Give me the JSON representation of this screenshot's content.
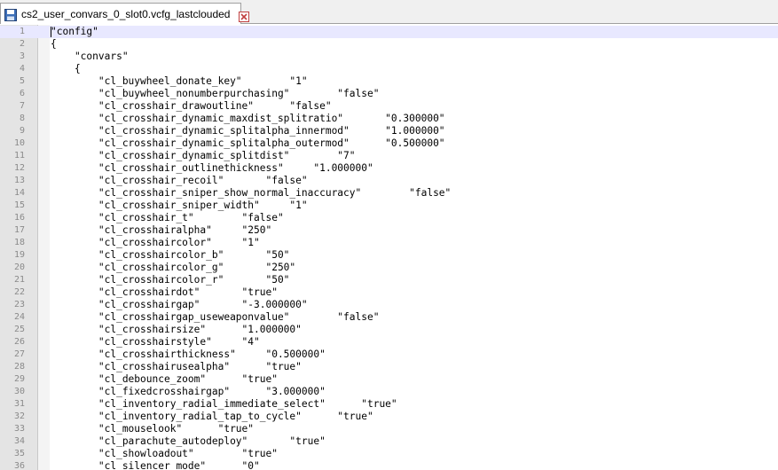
{
  "tab": {
    "title": "cs2_user_convars_0_slot0.vcfg_lastclouded"
  },
  "lines": [
    {
      "n": "1",
      "text": "\"config\""
    },
    {
      "n": "2",
      "text": "{"
    },
    {
      "n": "3",
      "text": "    \"convars\""
    },
    {
      "n": "4",
      "text": "    {"
    },
    {
      "n": "5",
      "text": "        \"cl_buywheel_donate_key\"        \"1\""
    },
    {
      "n": "6",
      "text": "        \"cl_buywheel_nonumberpurchasing\"        \"false\""
    },
    {
      "n": "7",
      "text": "        \"cl_crosshair_drawoutline\"      \"false\""
    },
    {
      "n": "8",
      "text": "        \"cl_crosshair_dynamic_maxdist_splitratio\"       \"0.300000\""
    },
    {
      "n": "9",
      "text": "        \"cl_crosshair_dynamic_splitalpha_innermod\"      \"1.000000\""
    },
    {
      "n": "10",
      "text": "        \"cl_crosshair_dynamic_splitalpha_outermod\"      \"0.500000\""
    },
    {
      "n": "11",
      "text": "        \"cl_crosshair_dynamic_splitdist\"        \"7\""
    },
    {
      "n": "12",
      "text": "        \"cl_crosshair_outlinethickness\"     \"1.000000\""
    },
    {
      "n": "13",
      "text": "        \"cl_crosshair_recoil\"       \"false\""
    },
    {
      "n": "14",
      "text": "        \"cl_crosshair_sniper_show_normal_inaccuracy\"        \"false\""
    },
    {
      "n": "15",
      "text": "        \"cl_crosshair_sniper_width\"     \"1\""
    },
    {
      "n": "16",
      "text": "        \"cl_crosshair_t\"        \"false\""
    },
    {
      "n": "17",
      "text": "        \"cl_crosshairalpha\"     \"250\""
    },
    {
      "n": "18",
      "text": "        \"cl_crosshaircolor\"     \"1\""
    },
    {
      "n": "19",
      "text": "        \"cl_crosshaircolor_b\"       \"50\""
    },
    {
      "n": "20",
      "text": "        \"cl_crosshaircolor_g\"       \"250\""
    },
    {
      "n": "21",
      "text": "        \"cl_crosshaircolor_r\"       \"50\""
    },
    {
      "n": "22",
      "text": "        \"cl_crosshairdot\"       \"true\""
    },
    {
      "n": "23",
      "text": "        \"cl_crosshairgap\"       \"-3.000000\""
    },
    {
      "n": "24",
      "text": "        \"cl_crosshairgap_useweaponvalue\"        \"false\""
    },
    {
      "n": "25",
      "text": "        \"cl_crosshairsize\"      \"1.000000\""
    },
    {
      "n": "26",
      "text": "        \"cl_crosshairstyle\"     \"4\""
    },
    {
      "n": "27",
      "text": "        \"cl_crosshairthickness\"     \"0.500000\""
    },
    {
      "n": "28",
      "text": "        \"cl_crosshairusealpha\"      \"true\""
    },
    {
      "n": "29",
      "text": "        \"cl_debounce_zoom\"      \"true\""
    },
    {
      "n": "30",
      "text": "        \"cl_fixedcrosshairgap\"      \"3.000000\""
    },
    {
      "n": "31",
      "text": "        \"cl_inventory_radial_immediate_select\"      \"true\""
    },
    {
      "n": "32",
      "text": "        \"cl_inventory_radial_tap_to_cycle\"      \"true\""
    },
    {
      "n": "33",
      "text": "        \"cl_mouselook\"      \"true\""
    },
    {
      "n": "34",
      "text": "        \"cl_parachute_autodeploy\"       \"true\""
    },
    {
      "n": "35",
      "text": "        \"cl_showloadout\"        \"true\""
    },
    {
      "n": "36",
      "text": "        \"cl_silencer_mode\"      \"0\""
    }
  ]
}
